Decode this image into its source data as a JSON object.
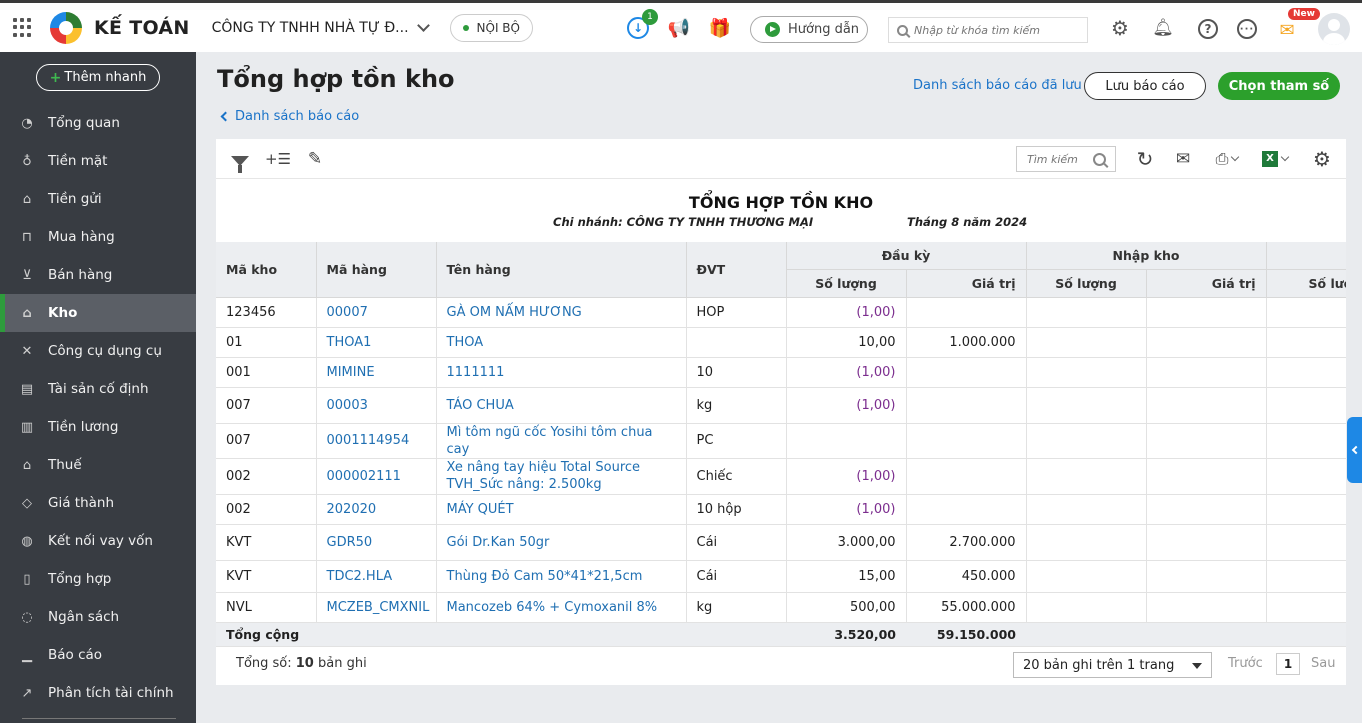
{
  "topbar": {
    "brand": "KẾ TOÁN",
    "company": "CÔNG TY TNHH NHÀ TỰ Đ...",
    "scope": "NỘI BỘ",
    "download_badge": "1",
    "help_label": "Hướng dẫn",
    "search_placeholder": "Nhập từ khóa tìm kiếm",
    "new_badge": "New",
    "icons": [
      "apps-grid-icon",
      "download-icon",
      "megaphone-icon",
      "gift-icon",
      "settings-icon",
      "bell-icon",
      "help-icon",
      "chat-icon",
      "mail-new-icon",
      "avatar"
    ],
    "colors": {
      "accent_green": "#2ca02c",
      "link_blue": "#1a73c8",
      "negative_purple": "#7b2d8e"
    }
  },
  "sidebar": {
    "quick_add": "Thêm nhanh",
    "items": [
      {
        "label": "Tổng quan",
        "icon": "dashboard-icon",
        "glyph": "◔"
      },
      {
        "label": "Tiền mặt",
        "icon": "cash-bag-icon",
        "glyph": "♁"
      },
      {
        "label": "Tiền gửi",
        "icon": "bank-icon",
        "glyph": "⌂"
      },
      {
        "label": "Mua hàng",
        "icon": "shopping-bag-icon",
        "glyph": "⊓"
      },
      {
        "label": "Bán hàng",
        "icon": "cart-icon",
        "glyph": "⊻"
      },
      {
        "label": "Kho",
        "icon": "warehouse-icon",
        "glyph": "⌂",
        "active": true
      },
      {
        "label": "Công cụ dụng cụ",
        "icon": "tools-icon",
        "glyph": "✕"
      },
      {
        "label": "Tài sản cố định",
        "icon": "asset-icon",
        "glyph": "▤"
      },
      {
        "label": "Tiền lương",
        "icon": "payroll-icon",
        "glyph": "▥"
      },
      {
        "label": "Thuế",
        "icon": "tax-icon",
        "glyph": "⌂"
      },
      {
        "label": "Giá thành",
        "icon": "price-tag-icon",
        "glyph": "◇"
      },
      {
        "label": "Kết nối vay vốn",
        "icon": "loan-icon",
        "glyph": "◍"
      },
      {
        "label": "Tổng hợp",
        "icon": "summary-doc-icon",
        "glyph": "▯"
      },
      {
        "label": "Ngân sách",
        "icon": "budget-icon",
        "glyph": "◌"
      },
      {
        "label": "Báo cáo",
        "icon": "bar-chart-icon",
        "glyph": "▁"
      },
      {
        "label": "Phân tích tài chính",
        "icon": "analytics-icon",
        "glyph": "↗"
      }
    ]
  },
  "header": {
    "title": "Tổng hợp tồn kho",
    "back_link": "Danh sách báo cáo",
    "saved_reports": "Danh sách báo cáo đã lưu",
    "save_button": "Lưu báo cáo",
    "params_button": "Chọn tham số"
  },
  "toolbar": {
    "search_placeholder": "Tìm kiếm",
    "icons": [
      "filter-icon",
      "add-column-icon",
      "edit-icon",
      "refresh-icon",
      "email-icon",
      "print-icon",
      "excel-icon",
      "grid-settings-icon"
    ]
  },
  "report": {
    "title": "TỔNG HỢP TỒN KHO",
    "branch": "Chi nhánh: CÔNG TY TNHH THƯƠNG MẠI",
    "period": "Tháng 8 năm 2024"
  },
  "table": {
    "headers": {
      "warehouse_code": "Mã kho",
      "item_code": "Mã hàng",
      "item_name": "Tên hàng",
      "unit": "ĐVT",
      "opening": "Đầu kỳ",
      "receipt": "Nhập kho",
      "quantity": "Số lượng",
      "value": "Giá trị",
      "quantity_cut": "Số lượ"
    },
    "rows": [
      {
        "wh": "123456",
        "code": "00007",
        "name": "GÀ OM NẤM HƯƠNG",
        "unit": "HOP",
        "qty": "(1,00)",
        "val": "",
        "neg": true
      },
      {
        "wh": "01",
        "code": "THOA1",
        "name": "THOA",
        "unit": "",
        "qty": "10,00",
        "val": "1.000.000",
        "neg": false
      },
      {
        "wh": "001",
        "code": "MIMINE",
        "name": "1111111",
        "unit": "10",
        "qty": "(1,00)",
        "val": "",
        "neg": true
      },
      {
        "wh": "007",
        "code": "00003",
        "name": "TÁO CHUA",
        "unit": "kg",
        "qty": "(1,00)",
        "val": "",
        "neg": true
      },
      {
        "wh": "007",
        "code": "0001114954",
        "name": "Mì tôm ngũ cốc Yosihi tôm chua cay",
        "unit": "PC",
        "qty": "",
        "val": "",
        "neg": false
      },
      {
        "wh": "002",
        "code": "000002111",
        "name": "Xe nâng tay hiệu Total Source TVH_Sức nâng: 2.500kg",
        "unit": "Chiếc",
        "qty": "(1,00)",
        "val": "",
        "neg": true
      },
      {
        "wh": "002",
        "code": "202020",
        "name": "MÁY QUÉT",
        "unit": "10 hộp",
        "qty": "(1,00)",
        "val": "",
        "neg": true
      },
      {
        "wh": "KVT",
        "code": "GDR50",
        "name": "Gói Dr.Kan 50gr",
        "unit": "Cái",
        "qty": "3.000,00",
        "val": "2.700.000",
        "neg": false
      },
      {
        "wh": "KVT",
        "code": "TDC2.HLA",
        "name": "Thùng Đỏ Cam 50*41*21,5cm",
        "unit": "Cái",
        "qty": "15,00",
        "val": "450.000",
        "neg": false
      },
      {
        "wh": "NVL",
        "code": "MCZEB_CMXNIL",
        "name": "Mancozeb 64% + Cymoxanil 8%",
        "unit": "kg",
        "qty": "500,00",
        "val": "55.000.000",
        "neg": false
      }
    ],
    "total": {
      "label": "Tổng cộng",
      "qty": "3.520,00",
      "val": "59.150.000"
    }
  },
  "footer": {
    "total_prefix": "Tổng số: ",
    "total_count": "10",
    "total_suffix": " bản ghi",
    "page_size": "20 bản ghi trên 1 trang",
    "prev": "Trước",
    "page": "1",
    "next": "Sau"
  }
}
